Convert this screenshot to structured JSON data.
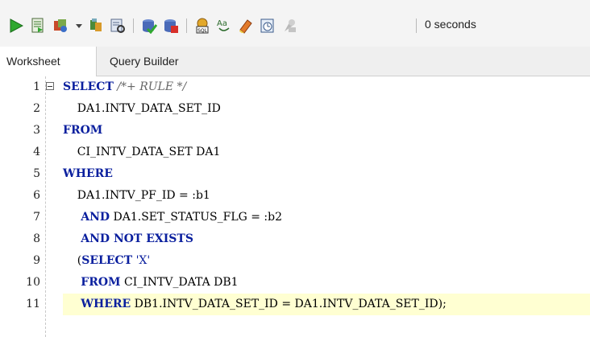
{
  "toolbar": {
    "icons": [
      "run-statement-icon",
      "run-script-icon",
      "autotrace-icon",
      "dropdown-arrow-icon",
      "explain-plan-icon",
      "sql-tuning-icon",
      "commit-icon",
      "rollback-icon",
      "sql-history-icon",
      "to-upper-lower-icon",
      "clear-icon",
      "sql-worksheet-history-icon",
      "disabled-tool-icon"
    ],
    "status": "0 seconds"
  },
  "tabs": [
    {
      "label": "Worksheet",
      "active": true
    },
    {
      "label": "Query Builder",
      "active": false
    }
  ],
  "editor": {
    "lines": [
      {
        "num": "1",
        "tokens": [
          {
            "t": "SELECT",
            "c": "kw"
          },
          {
            "t": " /*+ RULE */",
            "c": "cm"
          }
        ]
      },
      {
        "num": "2",
        "tokens": [
          {
            "t": "    DA1.INTV_DATA_SET_ID",
            "c": ""
          }
        ]
      },
      {
        "num": "3",
        "tokens": [
          {
            "t": "FROM",
            "c": "kw"
          }
        ]
      },
      {
        "num": "4",
        "tokens": [
          {
            "t": "    CI_INTV_DATA_SET DA1",
            "c": ""
          }
        ]
      },
      {
        "num": "5",
        "tokens": [
          {
            "t": "WHERE",
            "c": "kw"
          }
        ]
      },
      {
        "num": "6",
        "tokens": [
          {
            "t": "    DA1.INTV_PF_ID = :b1",
            "c": ""
          }
        ]
      },
      {
        "num": "7",
        "tokens": [
          {
            "t": "     ",
            "c": ""
          },
          {
            "t": "AND",
            "c": "kw"
          },
          {
            "t": " DA1.SET_STATUS_FLG = :b2",
            "c": ""
          }
        ]
      },
      {
        "num": "8",
        "tokens": [
          {
            "t": "     ",
            "c": ""
          },
          {
            "t": "AND NOT EXISTS",
            "c": "kw"
          }
        ]
      },
      {
        "num": "9",
        "tokens": [
          {
            "t": "    (",
            "c": ""
          },
          {
            "t": "SELECT",
            "c": "kw"
          },
          {
            "t": " 'X'",
            "c": "st"
          }
        ]
      },
      {
        "num": "10",
        "tokens": [
          {
            "t": "     ",
            "c": ""
          },
          {
            "t": "FROM",
            "c": "kw"
          },
          {
            "t": " CI_INTV_DATA DB1",
            "c": ""
          }
        ]
      },
      {
        "num": "11",
        "tokens": [
          {
            "t": "     ",
            "c": ""
          },
          {
            "t": "WHERE",
            "c": "kw"
          },
          {
            "t": " DB1.INTV_DATA_SET_ID = DA1.INTV_DATA_SET_ID);",
            "c": ""
          }
        ],
        "highlight": true
      }
    ]
  },
  "colors": {
    "keyword": "#0a1f9e",
    "comment": "#666666",
    "current_line": "#ffffd2",
    "run_green": "#2fa82f"
  }
}
